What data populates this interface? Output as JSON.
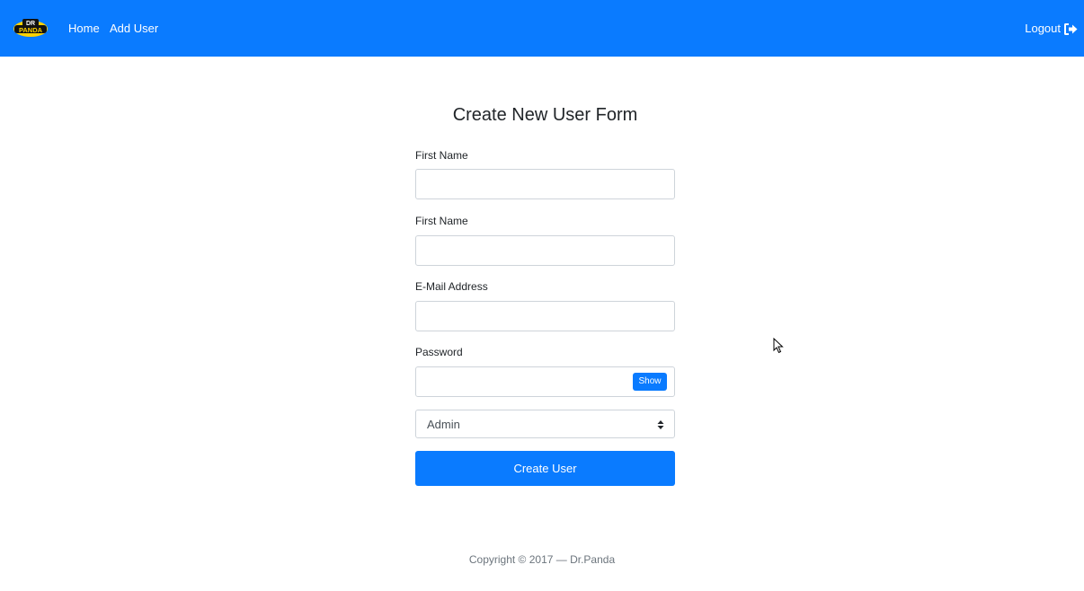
{
  "navbar": {
    "logo_text_top": "DR",
    "logo_text_bottom": "PANDA",
    "home_label": "Home",
    "add_user_label": "Add User",
    "logout_label": "Logout",
    "logout_icon": "sign-out-icon"
  },
  "form": {
    "title": "Create New User Form",
    "first_name_label": "First Name",
    "first_name_value": "",
    "last_name_label": "First Name",
    "last_name_value": "",
    "email_label": "E-Mail Address",
    "email_value": "",
    "password_label": "Password",
    "password_value": "",
    "show_label": "Show",
    "role_selected": "Admin",
    "submit_label": "Create User"
  },
  "footer": {
    "copyright": "Copyright © 2017 — Dr.Panda"
  },
  "colors": {
    "primary": "#0a7bff",
    "border": "#ced4da",
    "footer_text": "#6c757d"
  }
}
